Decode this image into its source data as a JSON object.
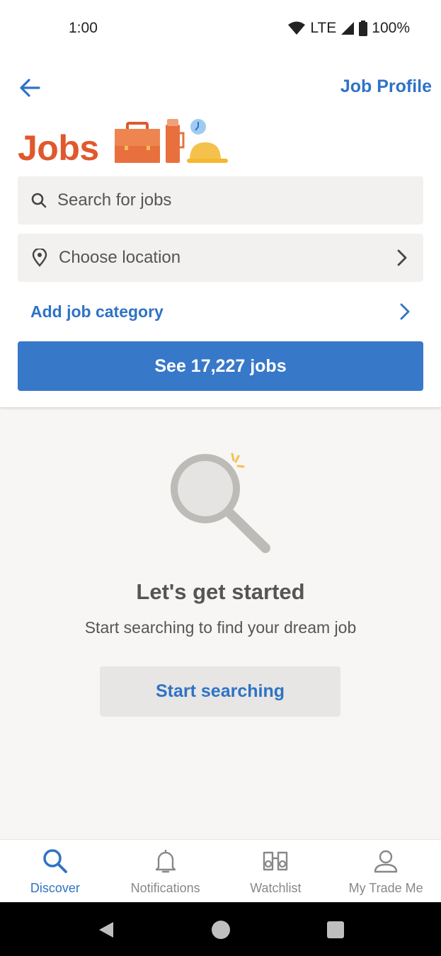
{
  "status_bar": {
    "time": "1:00",
    "network": "LTE",
    "battery": "100%"
  },
  "header": {
    "job_profile_label": "Job Profile",
    "title": "Jobs"
  },
  "search": {
    "placeholder": "Search for jobs"
  },
  "location": {
    "placeholder": "Choose location"
  },
  "category": {
    "label": "Add job category"
  },
  "see_jobs_button": "See 17,227 jobs",
  "empty_state": {
    "title": "Let's get started",
    "subtitle": "Start searching to find your dream job",
    "button": "Start searching"
  },
  "bottom_nav": {
    "items": [
      {
        "label": "Discover",
        "icon": "search-icon",
        "active": true
      },
      {
        "label": "Notifications",
        "icon": "bell-icon",
        "active": false
      },
      {
        "label": "Watchlist",
        "icon": "binoculars-icon",
        "active": false
      },
      {
        "label": "My Trade Me",
        "icon": "person-icon",
        "active": false
      }
    ]
  },
  "colors": {
    "accent": "#2f73c5",
    "primary_button": "#3778c8",
    "brand_orange": "#e0582c"
  }
}
